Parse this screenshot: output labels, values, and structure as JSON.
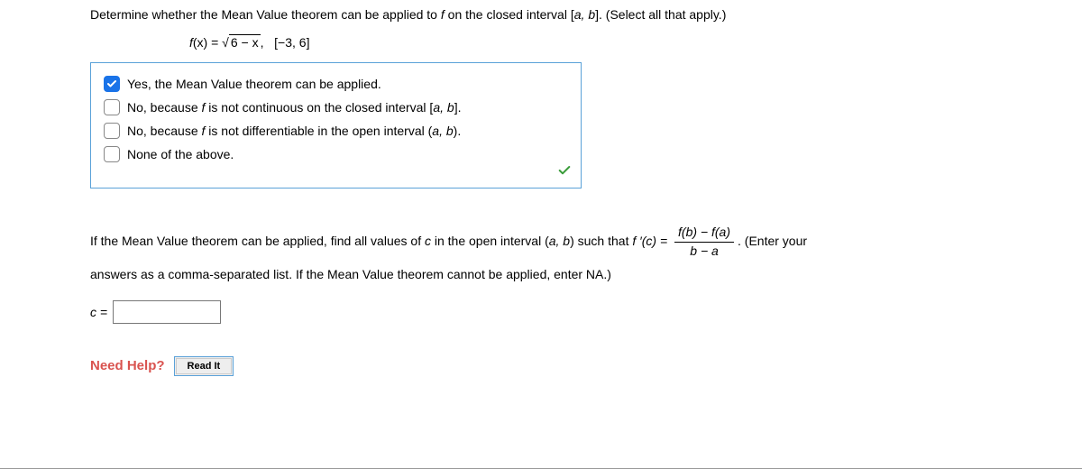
{
  "prompt": {
    "line1_a": "Determine whether the Mean Value theorem can be applied to ",
    "line1_f": "f",
    "line1_b": " on the closed interval [",
    "line1_ab": "a, b",
    "line1_c": "]. (Select all that apply.)",
    "func_lhs_f": "f",
    "func_lhs_paren": "(x) = ",
    "func_rad": "6 − x",
    "func_sep": ",",
    "func_interval": "[−3, 6]"
  },
  "options": [
    {
      "label": "Yes, the Mean Value theorem can be applied.",
      "checked": true
    },
    {
      "label_a": "No, because ",
      "label_f": "f",
      "label_b": " is not continuous on the closed interval [",
      "label_ab": "a, b",
      "label_c": "].",
      "checked": false
    },
    {
      "label_a": "No, because ",
      "label_f": "f",
      "label_b": " is not differentiable in the open interval (",
      "label_ab": "a, b",
      "label_c": ").",
      "checked": false
    },
    {
      "label": "None of the above.",
      "checked": false
    }
  ],
  "instruction": {
    "part1_a": "If the Mean Value theorem can be applied, find all values of ",
    "part1_c": "c",
    "part1_b": " in the open interval (",
    "part1_ab": "a, b",
    "part1_d": ") such that ",
    "part1_fprime": "f ′(c) = ",
    "frac_num": "f(b) − f(a)",
    "frac_den": "b − a",
    "part1_e": ". (Enter your",
    "part2": "answers as a comma-separated list. If the Mean Value theorem cannot be applied, enter NA.)"
  },
  "answer": {
    "label": "c =",
    "value": ""
  },
  "help": {
    "need_help": "Need Help?",
    "read_it": "Read It"
  }
}
